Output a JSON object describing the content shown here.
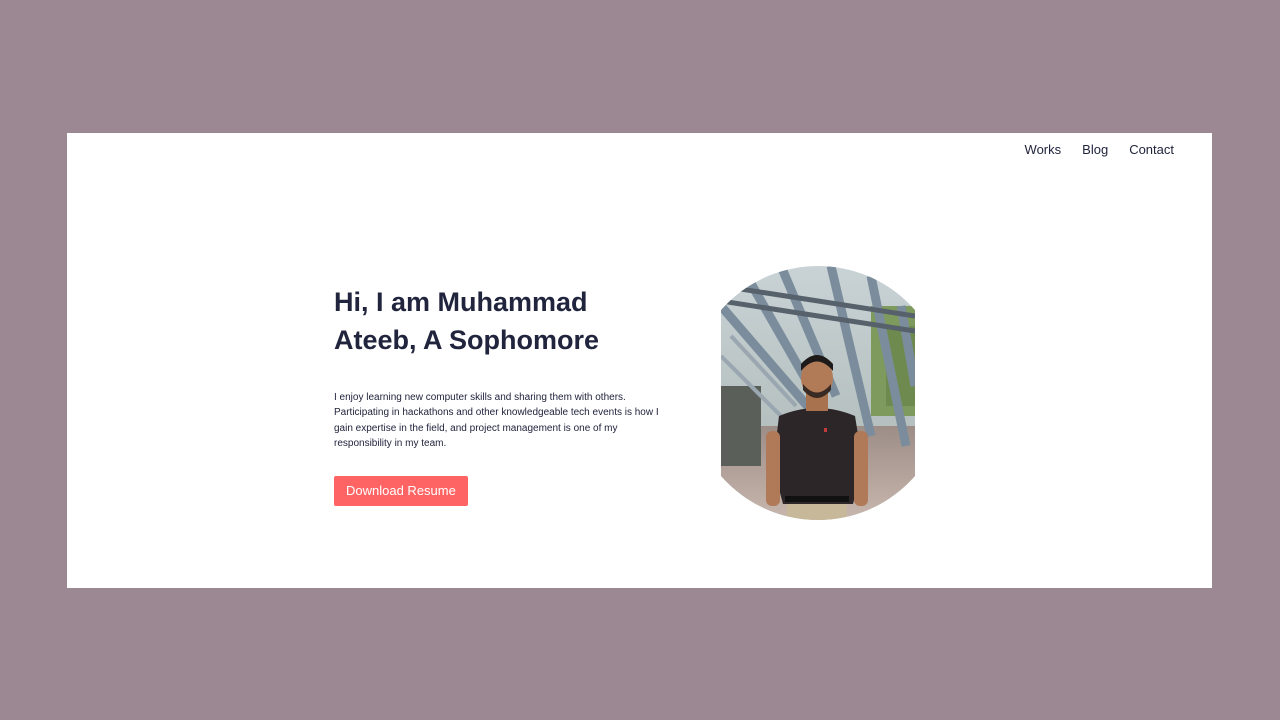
{
  "nav": {
    "items": [
      {
        "label": "Works"
      },
      {
        "label": "Blog"
      },
      {
        "label": "Contact"
      }
    ]
  },
  "hero": {
    "title": "Hi, I am Muhammad Ateeb, A Sophomore",
    "description": "I enjoy learning new computer skills and sharing them with others. Participating in hackathons and other knowledgeable tech events is how I gain expertise in the field, and project management is one of my responsibility in my team.",
    "button_label": "Download Resume"
  },
  "colors": {
    "page_background": "#9b8892",
    "card_background": "#ffffff",
    "text_dark": "#21243d",
    "accent": "#ff6464"
  }
}
